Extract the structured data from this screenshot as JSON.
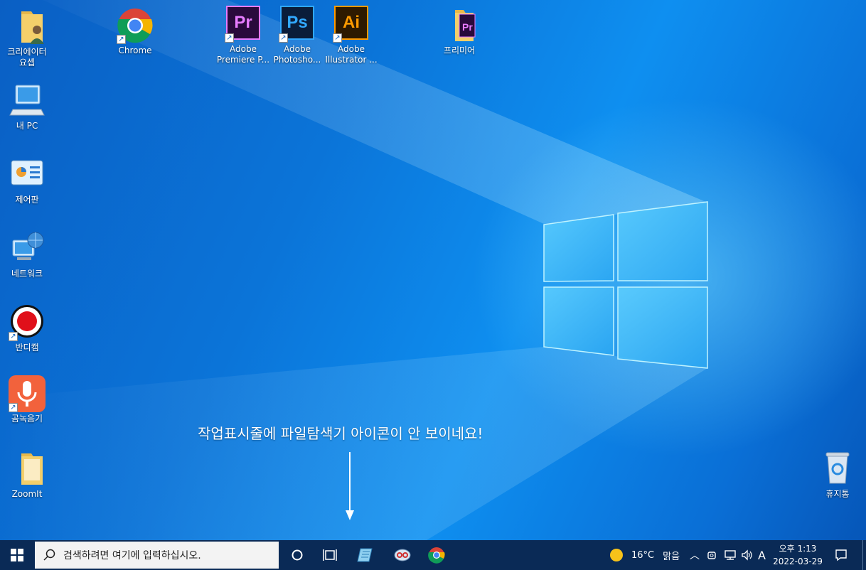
{
  "desktop_icons": [
    {
      "label_line1": "크리에이터",
      "label_line2": "요셉"
    },
    {
      "label_line1": "Chrome",
      "label_line2": ""
    },
    {
      "label_line1": "Adobe",
      "label_line2": "Premiere P..."
    },
    {
      "label_line1": "Adobe",
      "label_line2": "Photosho..."
    },
    {
      "label_line1": "Adobe",
      "label_line2": "Illustrator ..."
    },
    {
      "label_line1": "프리미어",
      "label_line2": ""
    },
    {
      "label_line1": "내 PC",
      "label_line2": ""
    },
    {
      "label_line1": "제어판",
      "label_line2": ""
    },
    {
      "label_line1": "네트워크",
      "label_line2": ""
    },
    {
      "label_line1": "반디캠",
      "label_line2": ""
    },
    {
      "label_line1": "곰녹음기",
      "label_line2": ""
    },
    {
      "label_line1": "ZoomIt",
      "label_line2": ""
    },
    {
      "label_line1": "휴지통",
      "label_line2": ""
    }
  ],
  "app_icon_text": {
    "pr": "Pr",
    "ps": "Ps",
    "ai": "Ai"
  },
  "annotation": "작업표시줄에 파일탐색기 아이콘이 안 보이네요!",
  "taskbar": {
    "search_placeholder": "검색하려면 여기에 입력하십시오.",
    "weather_temp": "16°C",
    "weather_desc": "맑음",
    "ime": "A",
    "time": "오후 1:13",
    "date": "2022-03-29"
  },
  "colors": {
    "desktop_blue": "#0b74d8",
    "taskbar": "#0a2a56",
    "premiere": "#2a0a3c",
    "premiere_accent": "#e77cff",
    "photoshop": "#0a1d3a",
    "photoshop_accent": "#31a8ff",
    "illustrator": "#2e1a00",
    "illustrator_accent": "#ff9a00"
  }
}
